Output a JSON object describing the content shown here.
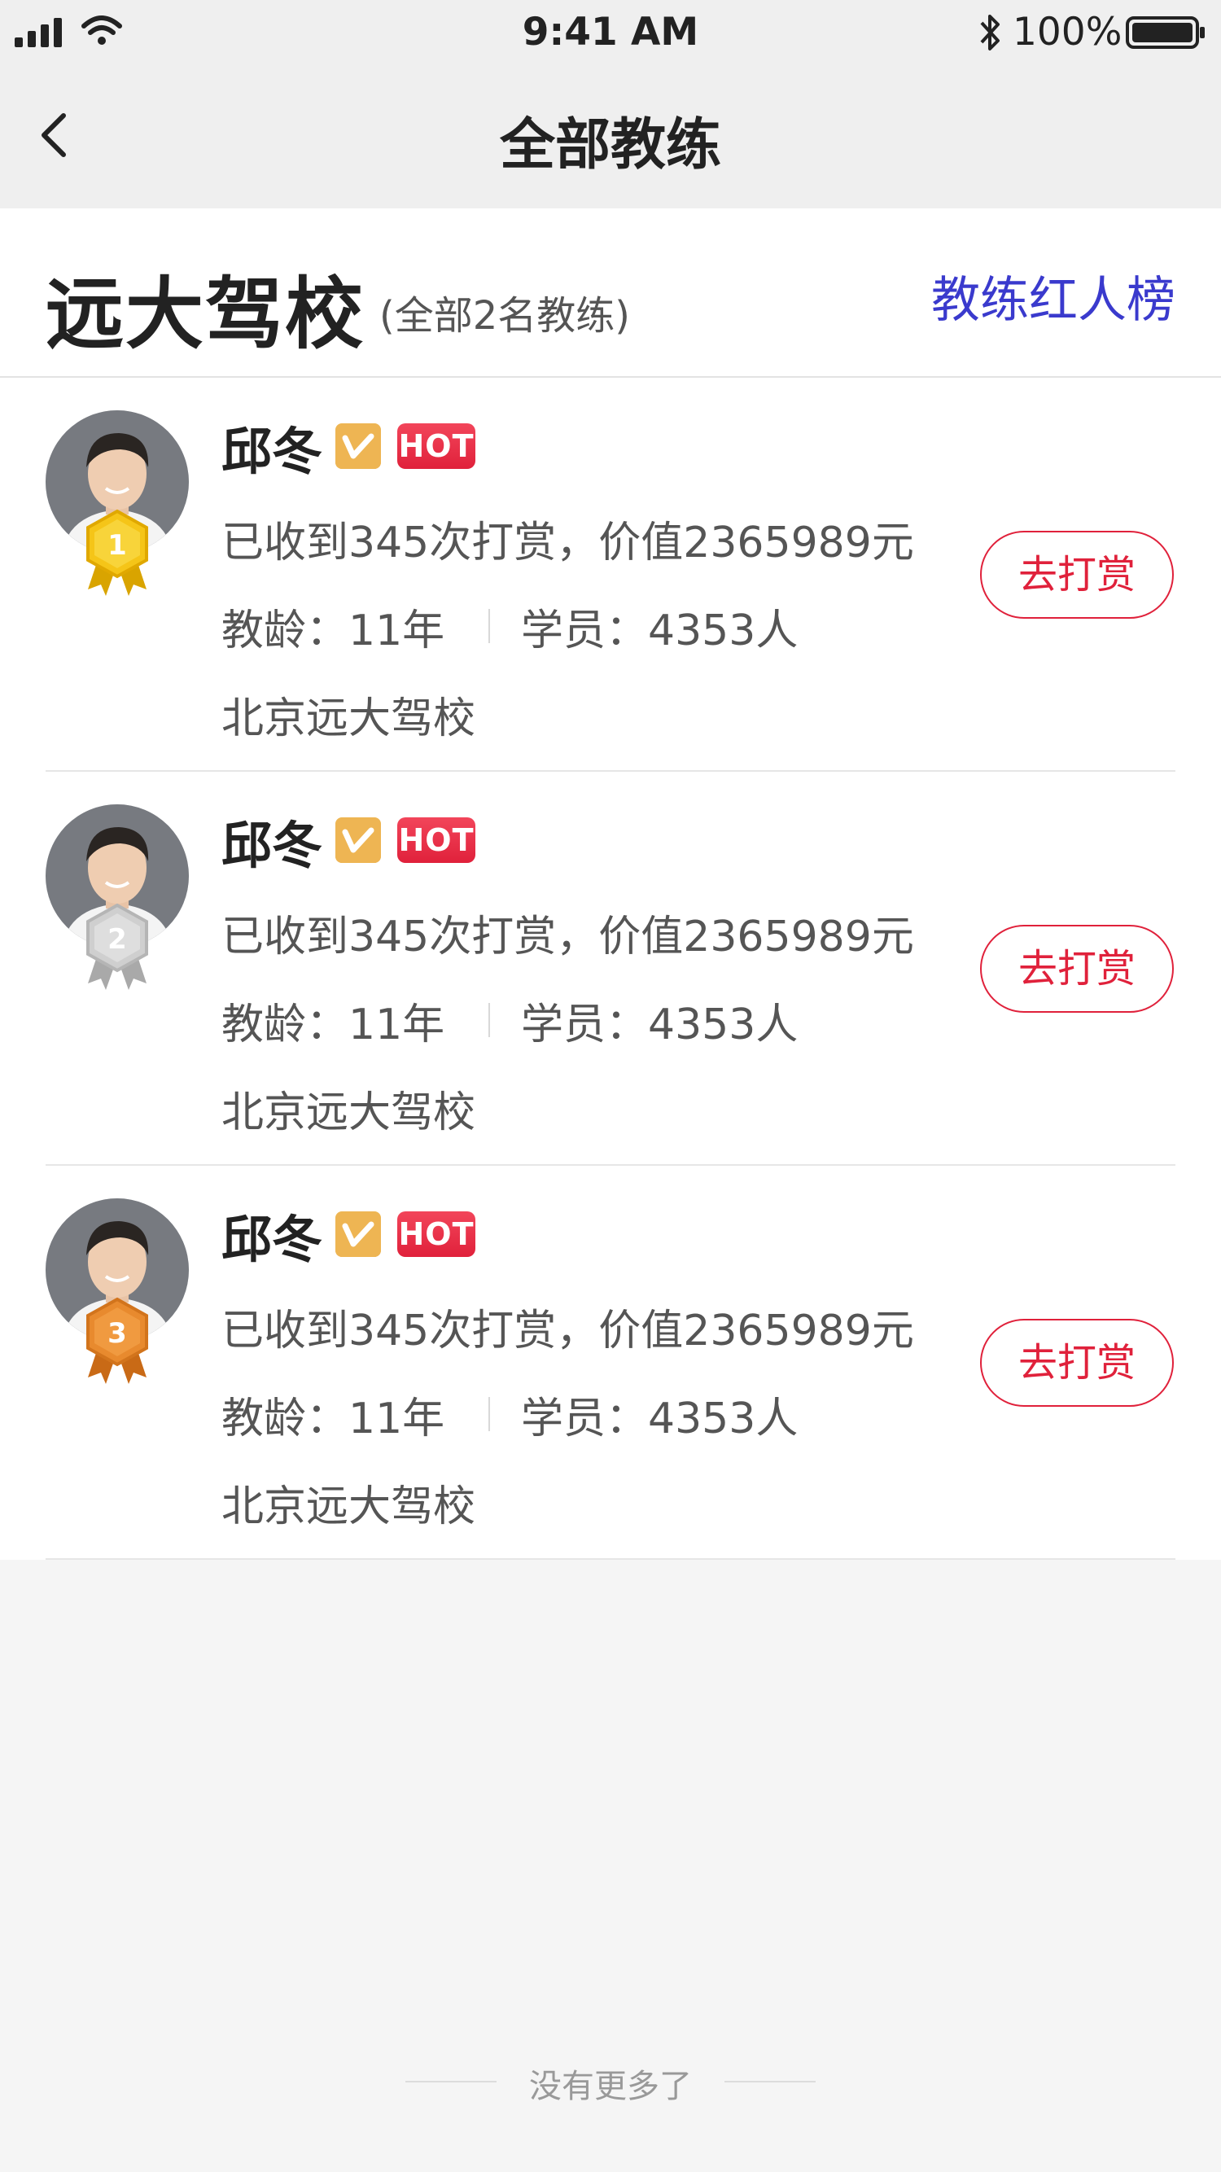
{
  "status_bar": {
    "time": "9:41 AM",
    "battery": "100%"
  },
  "nav": {
    "title": "全部教练",
    "back_icon": "chevron-left-icon"
  },
  "school": {
    "name": "远大驾校",
    "count_text": "(全部2名教练)",
    "rank_link": "教练红人榜"
  },
  "coaches": [
    {
      "rank": "1",
      "name": "邱冬",
      "hot": "HOT",
      "reward": "已收到345次打赏，价值2365989元",
      "years": "教龄：11年",
      "students": "学员：4353人",
      "school": "北京远大驾校",
      "button": "去打赏",
      "medal_color": "#f5c518"
    },
    {
      "rank": "2",
      "name": "邱冬",
      "hot": "HOT",
      "reward": "已收到345次打赏，价值2365989元",
      "years": "教龄：11年",
      "students": "学员：4353人",
      "school": "北京远大驾校",
      "button": "去打赏",
      "medal_color": "#c8c8c8"
    },
    {
      "rank": "3",
      "name": "邱冬",
      "hot": "HOT",
      "reward": "已收到345次打赏，价值2365989元",
      "years": "教龄：11年",
      "students": "学员：4353人",
      "school": "北京远大驾校",
      "button": "去打赏",
      "medal_color": "#e88a2e"
    }
  ],
  "footer": {
    "no_more": "没有更多了"
  },
  "colors": {
    "accent_red": "#e0213b",
    "link_blue": "#3a3acd"
  }
}
